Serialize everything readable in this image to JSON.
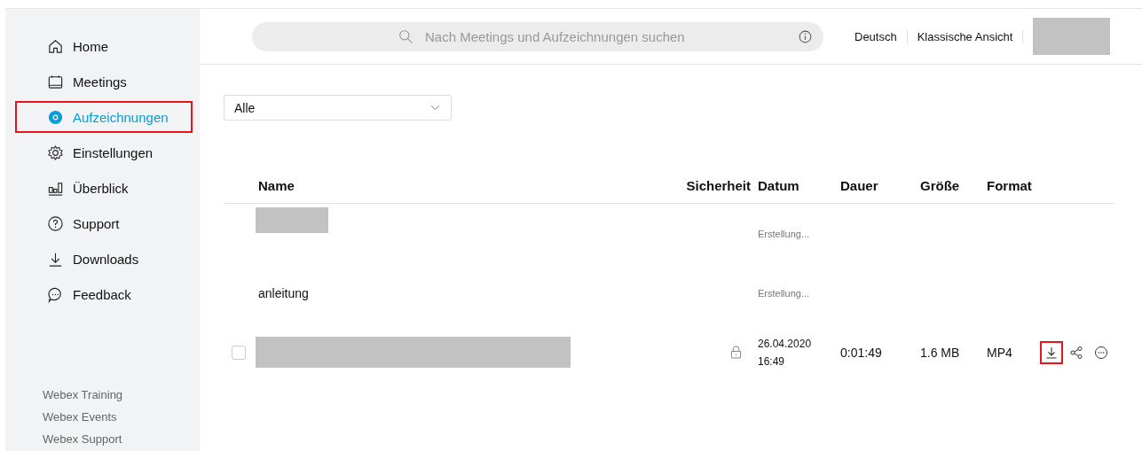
{
  "sidebar": {
    "items": [
      {
        "label": "Home",
        "selected": false,
        "highlighted": false
      },
      {
        "label": "Meetings",
        "selected": false,
        "highlighted": false
      },
      {
        "label": "Aufzeichnungen",
        "selected": true,
        "highlighted": true
      },
      {
        "label": "Einstellungen",
        "selected": false,
        "highlighted": false
      },
      {
        "label": "Überblick",
        "selected": false,
        "highlighted": false
      },
      {
        "label": "Support",
        "selected": false,
        "highlighted": false
      },
      {
        "label": "Downloads",
        "selected": false,
        "highlighted": false
      },
      {
        "label": "Feedback",
        "selected": false,
        "highlighted": false
      }
    ],
    "links": [
      "Webex Training",
      "Webex Events",
      "Webex Support"
    ]
  },
  "header": {
    "search": {
      "placeholder": "Nach Meetings und Aufzeichnungen suchen"
    },
    "links": [
      "Deutsch",
      "Klassische Ansicht"
    ],
    "avatar_redacted": true
  },
  "filter": {
    "value": "Alle"
  },
  "table": {
    "columns": [
      "Name",
      "Sicherheit",
      "Datum",
      "Dauer",
      "Größe",
      "Format"
    ],
    "rows": [
      {
        "name_redacted": true,
        "locked": false,
        "date": [
          "Erstellung..."
        ],
        "pending": true
      },
      {
        "name_redacted": false,
        "name": "anleitung",
        "locked": false,
        "date": [
          "Erstellung..."
        ],
        "pending": true
      },
      {
        "name_redacted": true,
        "checked": false,
        "locked": true,
        "date": [
          "26.04.2020",
          "16:49"
        ],
        "pending": false,
        "duration": "0:01:49",
        "size": "1.6 MB",
        "format": "MP4",
        "actions": [
          {
            "highlighted": true
          },
          {
            "highlighted": false
          },
          {
            "highlighted": false
          }
        ]
      }
    ]
  }
}
